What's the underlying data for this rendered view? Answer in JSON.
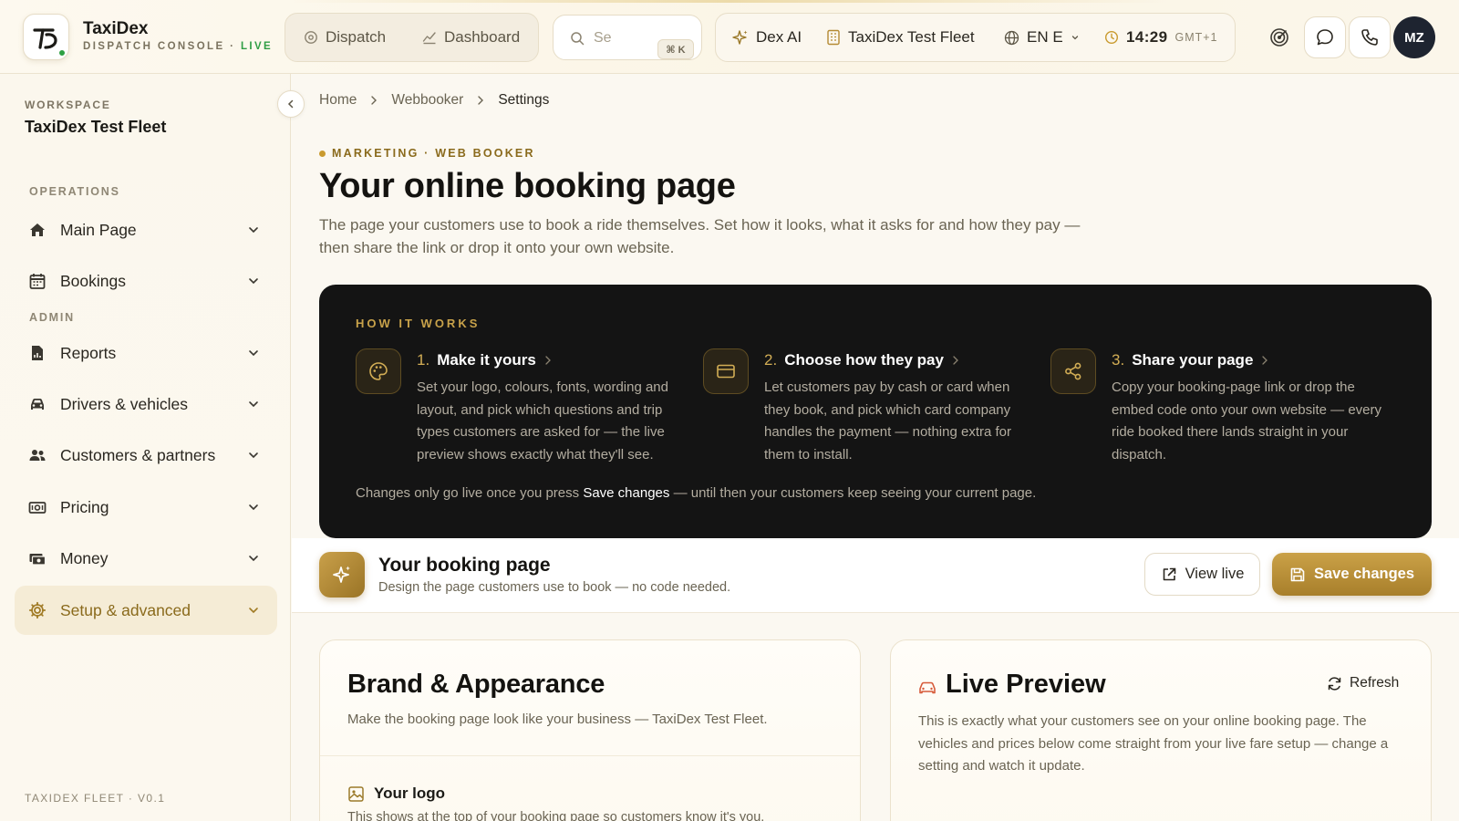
{
  "app": {
    "title": "TaxiDex",
    "subtitle": "DISPATCH CONSOLE · ",
    "live": "LIVE",
    "logo_icon": "taxidex-logo-icon",
    "accent": "#b48a33"
  },
  "topnav": {
    "tabs": [
      {
        "label": "Dispatch",
        "icon": "dispatch-icon"
      },
      {
        "label": "Dashboard",
        "icon": "dashboard-icon"
      }
    ]
  },
  "search": {
    "placeholder": "Se",
    "shortcut": "⌘ K"
  },
  "context": {
    "ai_label": "Dex AI",
    "fleet": "TaxiDex Test Fleet",
    "language": "EN English",
    "time": "14:29",
    "timezone": "GMT+1"
  },
  "user": {
    "initials": "MZ"
  },
  "sidebar": {
    "workspace_label": "WORKSPACE",
    "workspace_name": "TaxiDex Test Fleet",
    "sections": [
      {
        "label": "OPERATIONS"
      },
      {
        "label": "ADMIN"
      }
    ],
    "items": [
      {
        "label": "Main Page",
        "icon": "home-icon"
      },
      {
        "label": "Bookings",
        "icon": "calendar-icon"
      },
      {
        "label": "Reports",
        "icon": "report-icon"
      },
      {
        "label": "Drivers & vehicles",
        "icon": "car-icon"
      },
      {
        "label": "Customers & partners",
        "icon": "people-icon"
      },
      {
        "label": "Pricing",
        "icon": "price-tag-icon"
      },
      {
        "label": "Money",
        "icon": "money-icon"
      },
      {
        "label": "Setup & advanced",
        "icon": "settings-icon",
        "active": true
      }
    ],
    "footer": "TAXIDEX FLEET · V0.1"
  },
  "breadcrumb": [
    "Home",
    "Webbooker",
    "Settings"
  ],
  "page": {
    "eyebrow": "MARKETING · WEB BOOKER",
    "title": "Your online booking page",
    "description": "The page your customers use to book a ride themselves. Set how it looks, what it asks for and how they pay — then share the link or drop it onto your own website."
  },
  "how_it_works": {
    "label": "HOW IT WORKS",
    "steps": [
      {
        "num": "1.",
        "title": "Make it yours",
        "icon": "palette-icon",
        "desc": "Set your logo, colours, fonts, wording and layout, and pick which questions and trip types customers are asked for — the live preview shows exactly what they'll see."
      },
      {
        "num": "2.",
        "title": "Choose how they pay",
        "icon": "credit-card-icon",
        "desc": "Let customers pay by cash or card when they book, and pick which card company handles the payment — nothing extra for them to install."
      },
      {
        "num": "3.",
        "title": "Share your page",
        "icon": "share-icon",
        "desc": "Copy your booking-page link or drop the embed code onto your own website — every ride booked there lands straight in your dispatch."
      }
    ],
    "note_before": "Changes only go live once you press ",
    "note_bold": "Save changes",
    "note_after": " — until then your customers keep seeing your current page."
  },
  "booking_page_bar": {
    "title": "Your booking page",
    "subtitle": "Design the page customers use to book — no code needed.",
    "view_live": "View live",
    "save": "Save changes"
  },
  "brand_card": {
    "title": "Brand & Appearance",
    "subtitle": "Make the booking page look like your business — TaxiDex Test Fleet.",
    "logo_title": "Your logo",
    "logo_desc": "This shows at the top of your booking page so customers know it's you."
  },
  "preview_card": {
    "title": "Live Preview",
    "refresh": "Refresh",
    "description": "This is exactly what your customers see on your online booking page. The vehicles and prices below come straight from your live fare setup — change a setting and watch it update."
  }
}
